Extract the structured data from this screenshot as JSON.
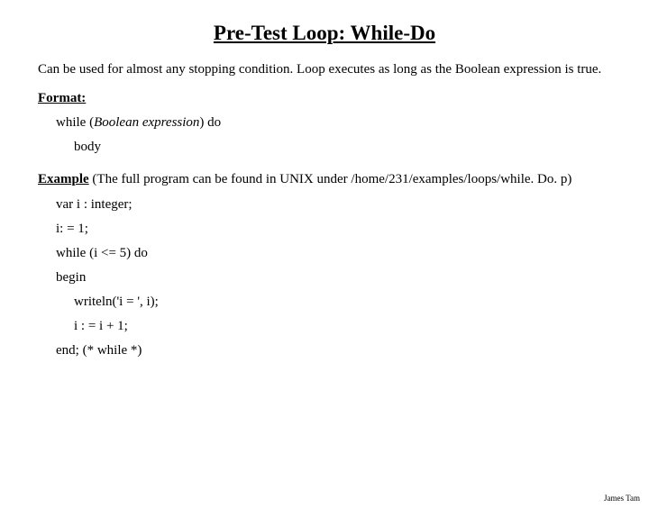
{
  "title": "Pre-Test Loop: While-Do",
  "intro": "Can be used for almost any stopping condition. Loop executes as long as the Boolean expression is true.",
  "format": {
    "label": "Format:",
    "line1_prefix": "while (",
    "line1_italic": "Boolean expression",
    "line1_suffix": ") do",
    "body": "body"
  },
  "example": {
    "label_leading": "Example",
    "label_rest": " (The full program can be found in UNIX under /home/231/examples/loops/while. Do. p)",
    "lines": {
      "l1": "var i : integer;",
      "l2": "i: = 1;",
      "l3": "while (i <= 5) do",
      "l4": "begin",
      "l5": "writeln('i = ', i);",
      "l6": "i : = i + 1;",
      "l7": "end; (* while *)"
    }
  },
  "footer": "James Tam"
}
